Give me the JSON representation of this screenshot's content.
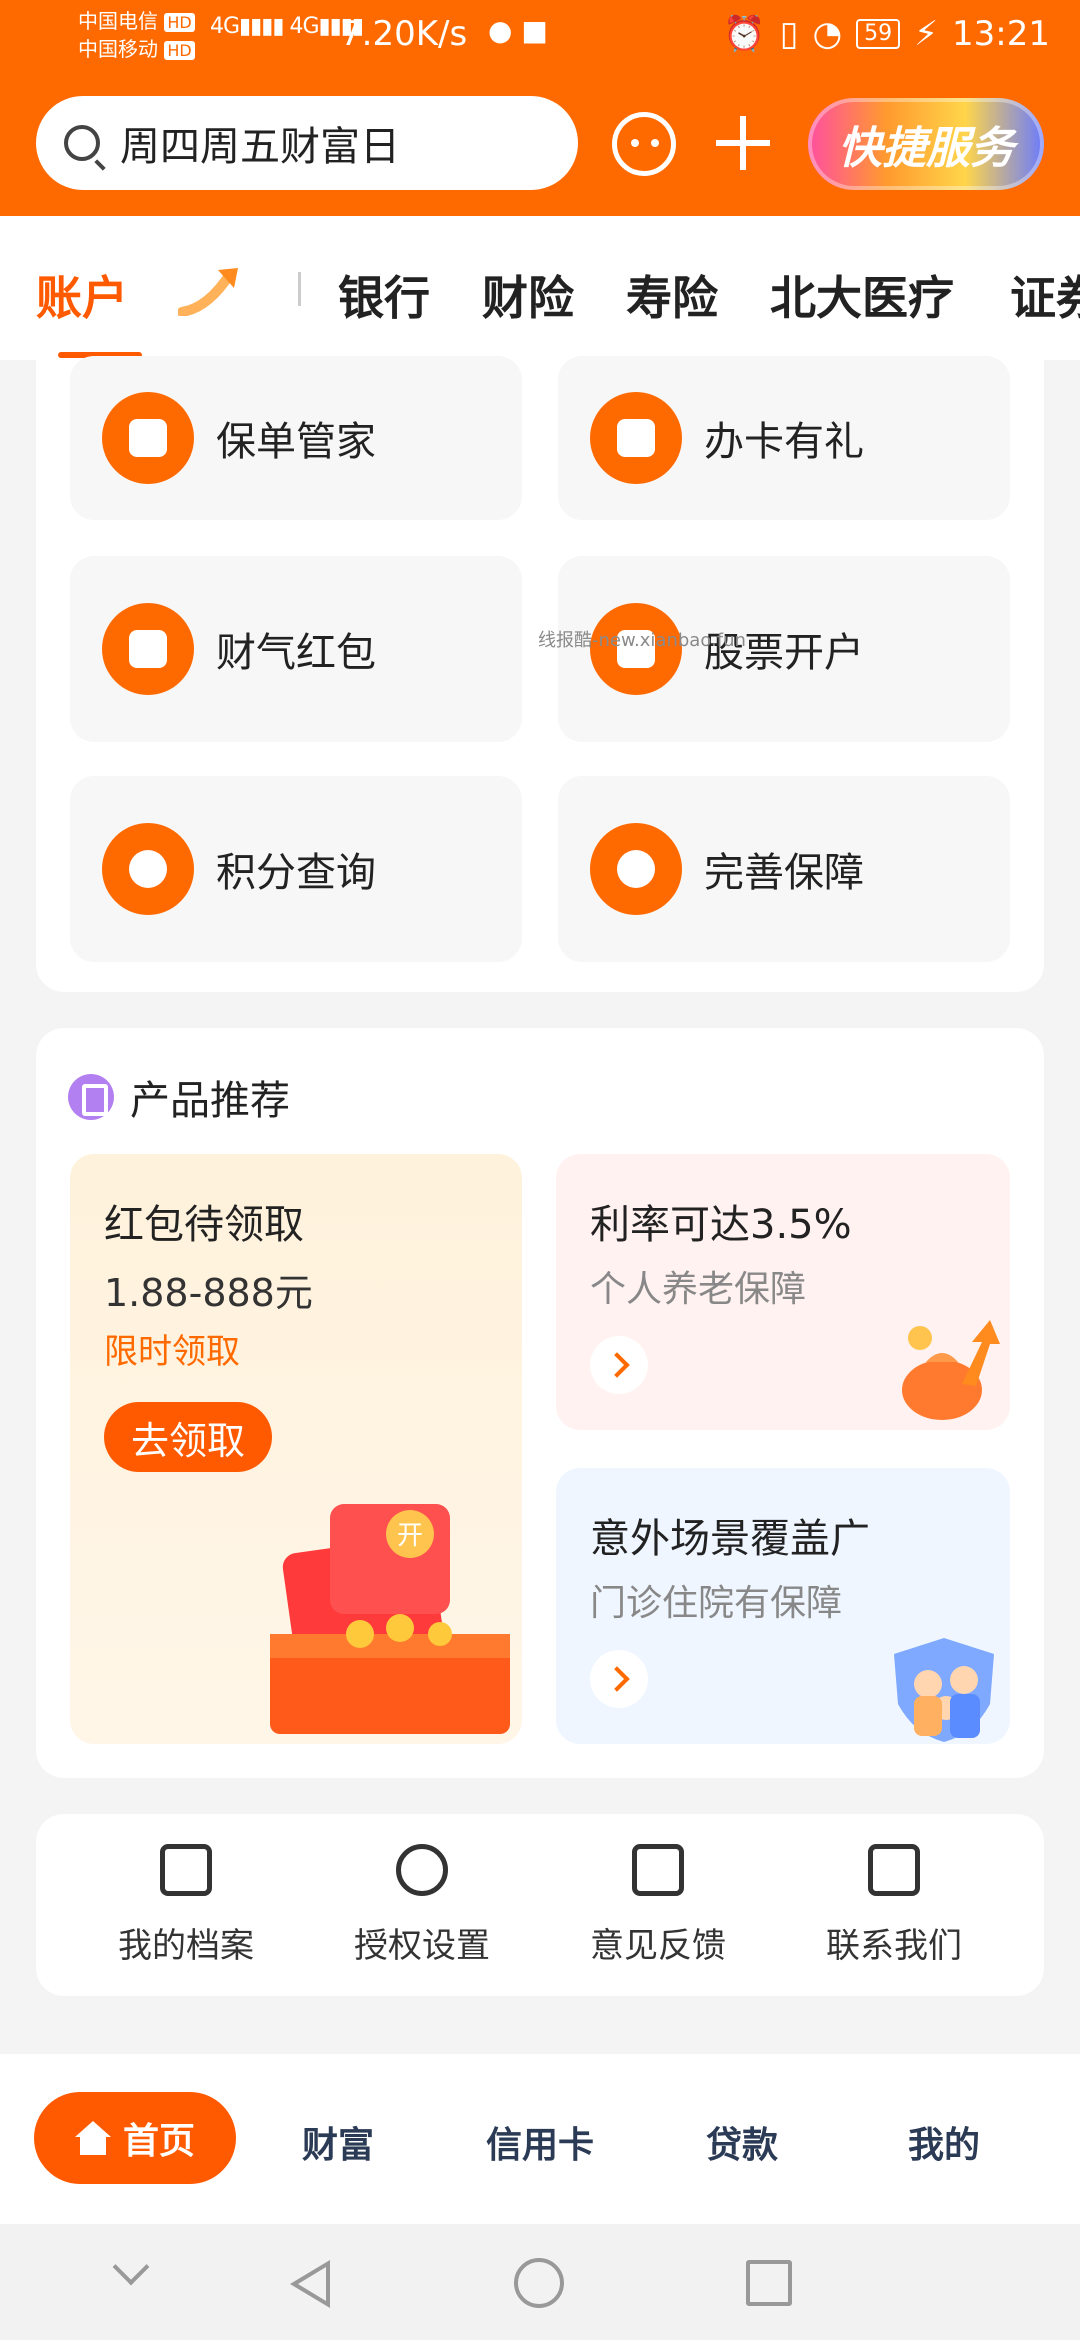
{
  "status_bar": {
    "carrier1": "中国电信",
    "carrier2": "中国移动",
    "hd": "HD",
    "net": "4G",
    "speed": "7.20K/s",
    "battery": "59",
    "time": "13:21"
  },
  "header": {
    "search_placeholder": "周四周五财富日",
    "quick_service_label": "快捷服务"
  },
  "tabs": [
    "账户",
    "银行",
    "财险",
    "寿险",
    "北大医疗",
    "证券"
  ],
  "services": [
    {
      "label": "保单管家",
      "icon": "policy-icon"
    },
    {
      "label": "办卡有礼",
      "icon": "tv-gift-icon"
    },
    {
      "label": "财气红包",
      "icon": "envelope-icon"
    },
    {
      "label": "股票开户",
      "icon": "receipt-icon"
    },
    {
      "label": "积分查询",
      "icon": "points-search-icon"
    },
    {
      "label": "完善保障",
      "icon": "pulse-search-icon"
    }
  ],
  "watermark": "线报酷-new.xianbao.fun",
  "products": {
    "title": "产品推荐",
    "left": {
      "title": "红包待领取",
      "amount": "1.88-888元",
      "tag": "限时领取",
      "button": "去领取",
      "gift_text": "开"
    },
    "right_top": {
      "title": "利率可达3.5%",
      "subtitle": "个人养老保障"
    },
    "right_bottom": {
      "title": "意外场景覆盖广",
      "subtitle": "门诊住院有保障"
    }
  },
  "links": [
    {
      "label": "我的档案",
      "icon": "archive-icon"
    },
    {
      "label": "授权设置",
      "icon": "settings-hex-icon"
    },
    {
      "label": "意见反馈",
      "icon": "feedback-icon"
    },
    {
      "label": "联系我们",
      "icon": "contact-icon"
    }
  ],
  "bottom_nav": {
    "home": "首页",
    "wealth": "财富",
    "credit": "信用卡",
    "loan": "贷款",
    "mine": "我的"
  },
  "colors": {
    "brand": "#ff6a00",
    "accent": "#ff5a00"
  }
}
